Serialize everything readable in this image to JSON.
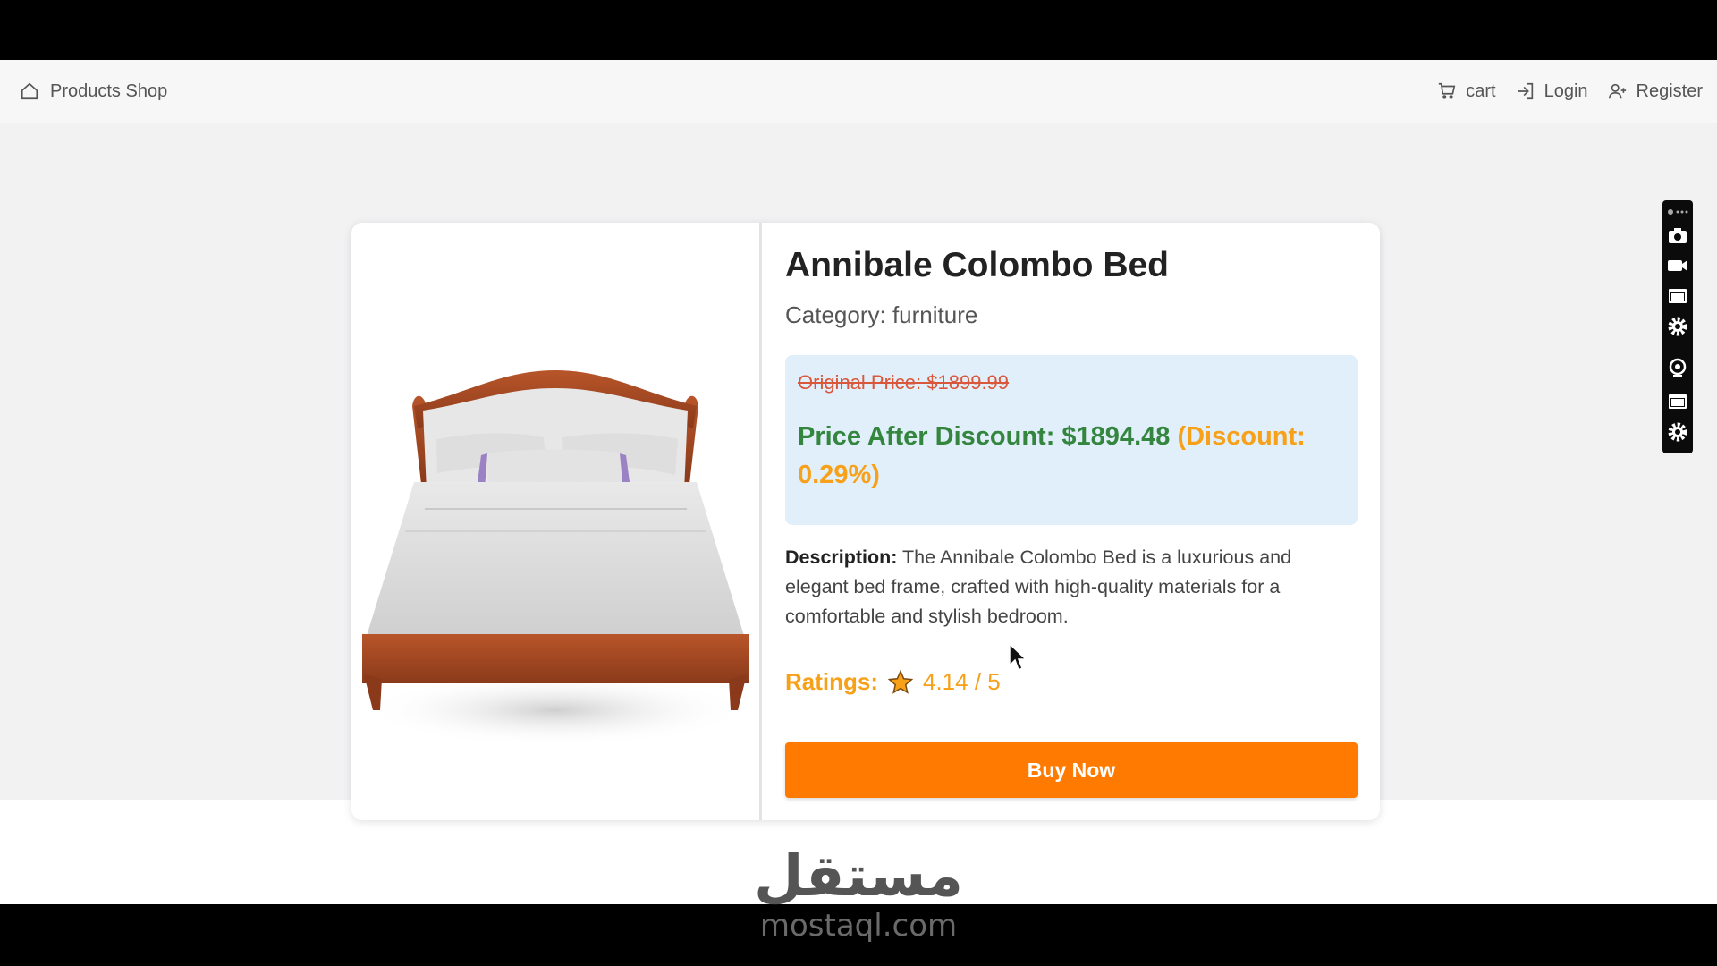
{
  "navbar": {
    "brand": "Products Shop",
    "links": [
      {
        "label": "cart",
        "icon": "cart-icon"
      },
      {
        "label": "Login",
        "icon": "login-icon"
      },
      {
        "label": "Register",
        "icon": "user-plus-icon"
      }
    ]
  },
  "product": {
    "title": "Annibale Colombo Bed",
    "category": "Category: furniture",
    "original_price": "Original Price: $1899.99",
    "discount_price": "Price After Discount: $1894.48",
    "discount_percent": "(Discount: 0.29%)",
    "description_label": "Description:",
    "description": " The Annibale Colombo Bed is a luxurious and elegant bed frame, crafted with high-quality materials for a comfortable and stylish bedroom.",
    "ratings_label": "Ratings:",
    "ratings_value": "4.14 / 5",
    "buy_label": "Buy Now",
    "image": "bed-image"
  },
  "toolbar": {
    "buttons": [
      "screenshot-icon",
      "video-icon",
      "window-icon",
      "settings-icon",
      "webcam-icon",
      "window-icon",
      "settings-icon"
    ]
  },
  "watermark": {
    "arabic": "مستقل",
    "latin": "mostaql.com"
  },
  "colors": {
    "accent": "#ff7a00",
    "discount_green": "#34863f",
    "rating_orange": "#f7a11a",
    "strike_red": "#d9573a",
    "price_box": "#e1effb"
  }
}
